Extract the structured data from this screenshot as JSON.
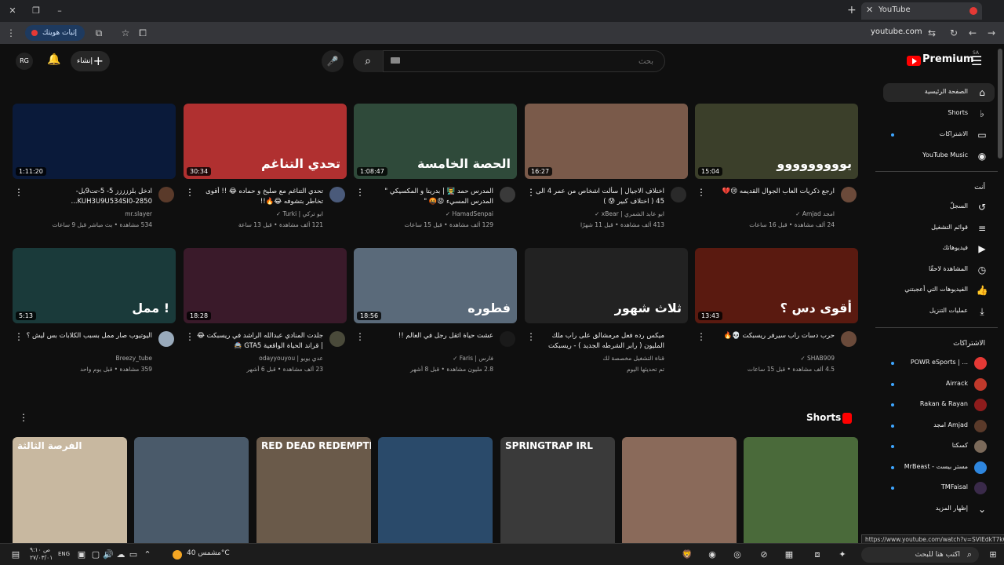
{
  "browser": {
    "tab_title": "YouTube",
    "url": "youtube.com",
    "install_label": "إثبات هويتك"
  },
  "header": {
    "avatar_text": "RG",
    "create_label": "إنشاء",
    "search_placeholder": "بحث",
    "logo_text": "Premium",
    "logo_sup": "SA"
  },
  "sidebar": {
    "main": [
      {
        "label": "الصفحة الرئيسية",
        "icon": "home-icon",
        "active": true
      },
      {
        "label": "Shorts",
        "icon": "shorts-icon"
      },
      {
        "label": "الاشتراكات",
        "icon": "subscriptions-icon",
        "dot": true
      },
      {
        "label": "YouTube Music",
        "icon": "music-icon"
      }
    ],
    "you_header": "أنت",
    "you": [
      {
        "label": "السجلّ",
        "icon": "history-icon"
      },
      {
        "label": "قوائم التشغيل",
        "icon": "playlist-icon"
      },
      {
        "label": "فيديوهاتك",
        "icon": "your-videos-icon"
      },
      {
        "label": "المشاهدة لاحقًا",
        "icon": "watch-later-icon"
      },
      {
        "label": "الفيديوهات التي أعجبتني",
        "icon": "like-icon"
      },
      {
        "label": "عمليات التنزيل",
        "icon": "download-icon"
      }
    ],
    "subs_header": "الاشتراكات",
    "subs": [
      {
        "label": "POWR eSports | ...",
        "color": "#e53935"
      },
      {
        "label": "Airrack",
        "color": "#c0392b"
      },
      {
        "label": "Rakan & Rayan",
        "color": "#8e1c1c"
      },
      {
        "label": "امجد Amjad",
        "color": "#5a3a2a"
      },
      {
        "label": "كسكتا",
        "color": "#7b6a5a"
      },
      {
        "label": "MrBeast - مستر بيست",
        "color": "#2e86de"
      },
      {
        "label": "TMFaisal",
        "color": "#3a2a4a"
      }
    ],
    "show_more": "إظهار المزيد"
  },
  "videos": [
    {
      "title": "ارجع ذكريات العاب الجوال القديمه 😢💔",
      "channel": "امجد Amjad ✓",
      "meta": "24 ألف مشاهدة • قبل 16 ساعات",
      "duration": "15:04",
      "thumb_text": "يووووووووو",
      "thumb_bg": "#3b3f2a",
      "avatar": "#6b4a3a"
    },
    {
      "title": "اختلاف الاجيال | سألت اشخاص من عمر 4 الى 45 ( اختلاف كبير 😰 )",
      "channel": "ابو عابد الشمري | xBear ✓",
      "meta": "413 ألف مشاهدة • قبل 11 شهرًا",
      "duration": "16:27",
      "thumb_text": "",
      "thumb_bg": "#7a5a4a",
      "avatar": "#2a2a2a"
    },
    {
      "title": "المدرس حمد 👨‍🏫 | بدريتا و المكسيكي \" المدرس المسيء 😡🤬 \"",
      "channel": "HamadSenpai ✓",
      "meta": "129 ألف مشاهدة • قبل 15 ساعات",
      "duration": "1:08:47",
      "thumb_text": "الحصة الخامسة",
      "thumb_bg": "#2f4a3a",
      "avatar": "#3a3a3a"
    },
    {
      "title": "تحدي التناغم مع صليخ و حماده 😂 !! أقوى تخاطر بتشوفه 😂🔥!!",
      "channel": "ابو تركي | Turki ✓",
      "meta": "121 ألف مشاهدة • قبل 13 ساعة",
      "duration": "30:34",
      "thumb_text": "تحدي التناغم",
      "thumb_bg": "#b03030",
      "avatar": "#4a5a7a"
    },
    {
      "title": "ادخل بلززززز 5- 5-تت9يل-KUH3U9U534SI0-2850...",
      "channel": "mr.slayer",
      "meta": "534 مشاهدة • بث مباشر قبل 9 ساعات",
      "duration": "1:11:20",
      "thumb_text": "",
      "thumb_bg": "#0a1a3a",
      "avatar": "#5a3a2a"
    },
    {
      "title": "حرب دسات راب سيرفر ريسبكت 💀🔥",
      "channel": "SHAB909 ✓",
      "meta": "4.5 ألف مشاهدة • قبل 15 ساعات",
      "duration": "13:43",
      "thumb_text": "أقوى دس ؟",
      "thumb_bg": "#5a1a10",
      "avatar": "#6a4a3a"
    },
    {
      "title": "ميكس رده فعل مرمشالق على راب ملك المليون ( رابر الشرطه الجديد ) - ريسبكت",
      "channel": "قناة التشغيل مخصصة لك",
      "meta": "تم تحديثها اليوم",
      "duration": "",
      "thumb_text": "ثلاث شهور",
      "thumb_bg": "#222",
      "avatar": ""
    },
    {
      "title": "عشت حياة اثقل رجل في العالم !!",
      "channel": "فارس | Faris ✓",
      "meta": "2.8 مليون مشاهدة • قبل 8 أشهر",
      "duration": "18:56",
      "thumb_text": "فطوره",
      "thumb_bg": "#5a6a7a",
      "avatar": "#1a1a1a"
    },
    {
      "title": "جلدت المنادي عبدالله الراشد في ريسبكت 😂 | قراند الحياة الواقعية GTA5 🚔",
      "channel": "عدي يويو | odayyouyou",
      "meta": "23 ألف مشاهدة • قبل 6 أشهر",
      "duration": "18:28",
      "thumb_text": "",
      "thumb_bg": "#3a1a2a",
      "avatar": "#4a4a3a"
    },
    {
      "title": "اليوتيوب صار ممل بسبب الكلابات بس ليش ؟",
      "channel": "Breezy_tube",
      "meta": "359 مشاهدة • قبل يوم واحد",
      "duration": "5:13",
      "thumb_text": "ممل !",
      "thumb_bg": "#1a3a3a",
      "avatar": "#9ab"
    }
  ],
  "shorts": {
    "title": "Shorts",
    "items": [
      {
        "text": "",
        "bg": "#4a6a3a"
      },
      {
        "text": "",
        "bg": "#8a6a5a"
      },
      {
        "text": "SPRINGTRAP IRL",
        "bg": "#3a3a3a"
      },
      {
        "text": "",
        "bg": "#2a4a6a"
      },
      {
        "text": "RED DEAD REDEMPTION",
        "bg": "#6a5a4a"
      },
      {
        "text": "",
        "bg": "#4a5a6a"
      },
      {
        "text": "الفرصة الثالثة",
        "bg": "#c8b8a0"
      }
    ]
  },
  "taskbar": {
    "search": "اكتب هنا للبحث",
    "weather": "مشمس 40°C",
    "lang": "ENG",
    "clock_time": "ص ٩:١٠",
    "clock_date": "٢٧/٠٣/٠١"
  },
  "status_url": "https://www.youtube.com/watch?v=SVIEdkT7kQ"
}
